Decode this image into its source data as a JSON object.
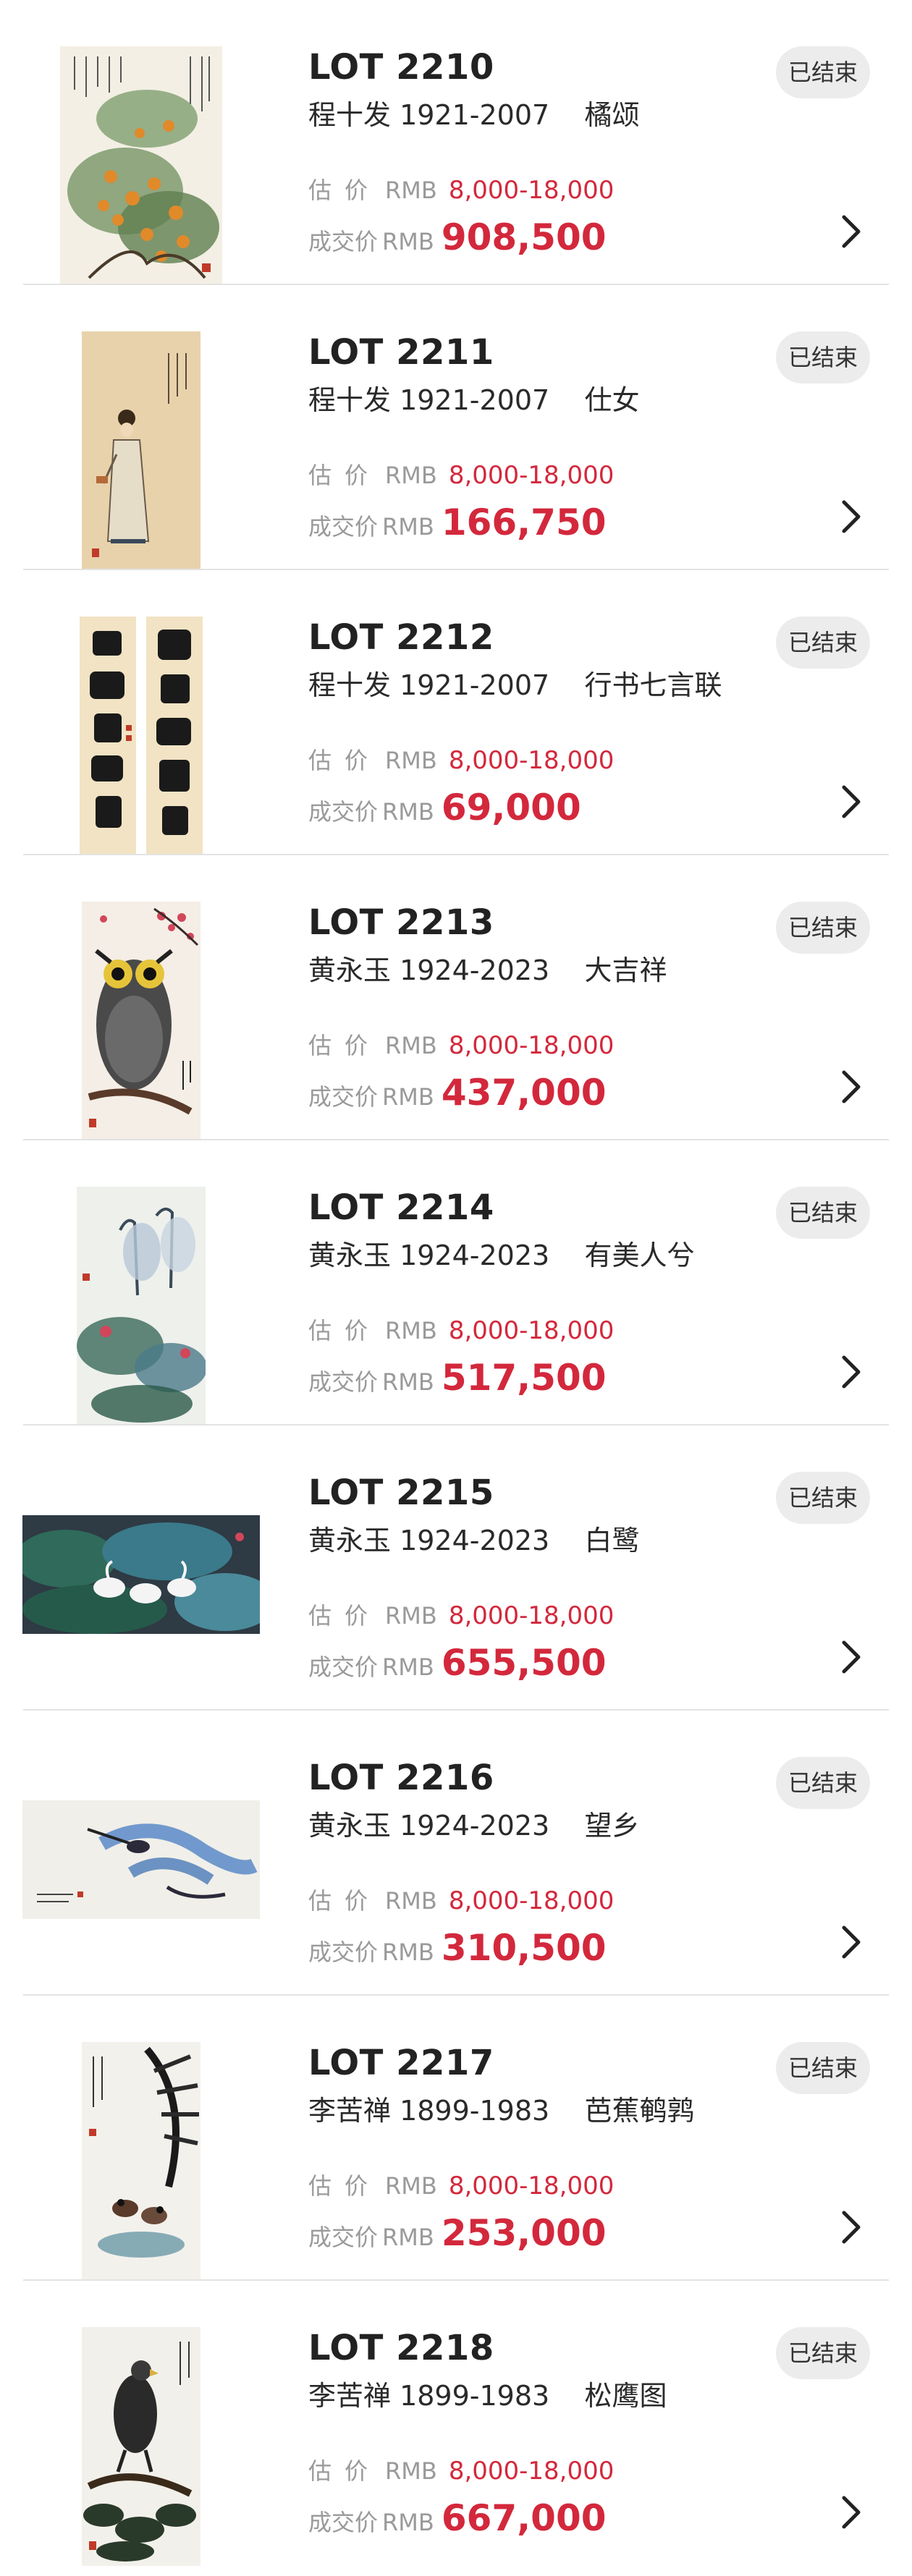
{
  "status_label": "已结束",
  "estimate_label": "估价",
  "price_label": "成交价",
  "currency": "RMB",
  "accent_color": "#d3283c",
  "lots": [
    {
      "number": "LOT 2210",
      "title": "程十发 1921-2007    橘颂",
      "estimate": "8,000-18,000",
      "price": "908,500",
      "image": "orange-tree-painting"
    },
    {
      "number": "LOT 2211",
      "title": "程十发 1921-2007    仕女",
      "estimate": "8,000-18,000",
      "price": "166,750",
      "image": "lady-figure-painting"
    },
    {
      "number": "LOT 2212",
      "title": "程十发 1921-2007    行书七言联",
      "estimate": "8,000-18,000",
      "price": "69,000",
      "image": "calligraphy-couplet"
    },
    {
      "number": "LOT 2213",
      "title": "黄永玉 1924-2023    大吉祥",
      "estimate": "8,000-18,000",
      "price": "437,000",
      "image": "owl-painting"
    },
    {
      "number": "LOT 2214",
      "title": "黄永玉 1924-2023    有美人兮",
      "estimate": "8,000-18,000",
      "price": "517,500",
      "image": "herons-lotus-painting"
    },
    {
      "number": "LOT 2215",
      "title": "黄永玉 1924-2023    白鹭",
      "estimate": "8,000-18,000",
      "price": "655,500",
      "image": "egrets-painting"
    },
    {
      "number": "LOT 2216",
      "title": "黄永玉 1924-2023    望乡",
      "estimate": "8,000-18,000",
      "price": "310,500",
      "image": "heron-blue-painting"
    },
    {
      "number": "LOT 2217",
      "title": "李苦禅 1899-1983    芭蕉鹌鹑",
      "estimate": "8,000-18,000",
      "price": "253,000",
      "image": "banana-quail-painting"
    },
    {
      "number": "LOT 2218",
      "title": "李苦禅 1899-1983    松鹰图",
      "estimate": "8,000-18,000",
      "price": "667,000",
      "image": "eagle-pine-painting"
    }
  ]
}
